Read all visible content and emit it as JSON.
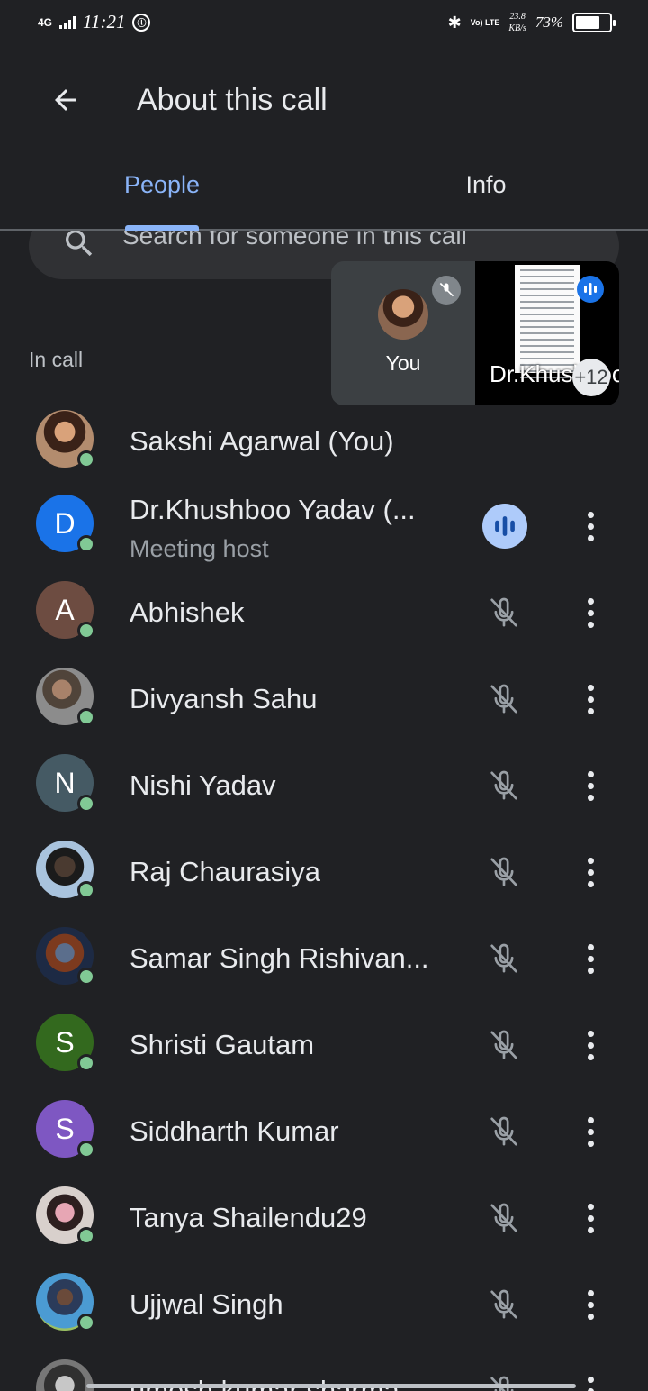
{
  "status_bar": {
    "network": "4G",
    "time": "11:21",
    "volte": "Vo) LTE",
    "speed": "23.8",
    "speed_unit": "KB/s",
    "battery": "73%",
    "battery_level": 0.73
  },
  "header": {
    "title": "About this call"
  },
  "tabs": [
    {
      "label": "People",
      "active": true
    },
    {
      "label": "Info",
      "active": false
    }
  ],
  "search": {
    "placeholder": "Search for someone in this call"
  },
  "section_label": "In call",
  "pip": {
    "self_label": "You",
    "other_name": "Dr.Khushboo",
    "more_count": "+12"
  },
  "participants": [
    {
      "name": "Sakshi Agarwal (You)",
      "subtitle": "",
      "initial": "",
      "status": "self"
    },
    {
      "name": "Dr.Khushboo Yadav (...",
      "subtitle": "Meeting host",
      "initial": "D",
      "status": "speaking"
    },
    {
      "name": "Abhishek",
      "subtitle": "",
      "initial": "A",
      "status": "muted"
    },
    {
      "name": "Divyansh Sahu",
      "subtitle": "",
      "initial": "",
      "status": "muted"
    },
    {
      "name": "Nishi Yadav",
      "subtitle": "",
      "initial": "N",
      "status": "muted"
    },
    {
      "name": "Raj Chaurasiya",
      "subtitle": "",
      "initial": "",
      "status": "muted"
    },
    {
      "name": "Samar Singh Rishivan...",
      "subtitle": "",
      "initial": "",
      "status": "muted"
    },
    {
      "name": "Shristi Gautam",
      "subtitle": "",
      "initial": "S",
      "status": "muted"
    },
    {
      "name": "Siddharth Kumar",
      "subtitle": "",
      "initial": "S",
      "status": "muted"
    },
    {
      "name": "Tanya Shailendu29",
      "subtitle": "",
      "initial": "",
      "status": "muted"
    },
    {
      "name": "Ujjwal Singh",
      "subtitle": "",
      "initial": "",
      "status": "muted"
    },
    {
      "name": "umesh kumar sharma",
      "subtitle": "",
      "initial": "",
      "status": "muted"
    }
  ],
  "colors": {
    "background": "#202124",
    "accent": "#8ab4f8",
    "online": "#81c995",
    "avatar_d": "#1a73e8",
    "avatar_a": "#6d4c41",
    "avatar_n": "#455a64",
    "avatar_s_green": "#33691e",
    "avatar_s_purple": "#7e57c2"
  }
}
